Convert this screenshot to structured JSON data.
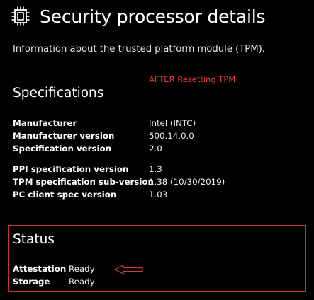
{
  "header": {
    "icon": "chip-icon",
    "title": "Security processor details",
    "subtitle": "Information about the trusted platform module (TPM)."
  },
  "annotation": {
    "text": "AFTER Resetting TPM",
    "color": "#e03a3a"
  },
  "specifications": {
    "heading": "Specifications",
    "group1": [
      {
        "label": "Manufacturer",
        "value": "Intel (INTC)"
      },
      {
        "label": "Manufacturer version",
        "value": "500.14.0.0"
      },
      {
        "label": "Specification version",
        "value": "2.0"
      }
    ],
    "group2": [
      {
        "label": "PPI specification version",
        "value": "1.3"
      },
      {
        "label": "TPM specification sub-version",
        "value": "1.38 (10/30/2019)"
      },
      {
        "label": "PC client spec version",
        "value": "1.03"
      }
    ]
  },
  "status": {
    "heading": "Status",
    "rows": [
      {
        "label": "Attestation",
        "value": "Ready"
      },
      {
        "label": "Storage",
        "value": "Ready"
      }
    ],
    "highlight_color": "#b63a3a",
    "arrow_icon": "left-arrow-icon"
  }
}
